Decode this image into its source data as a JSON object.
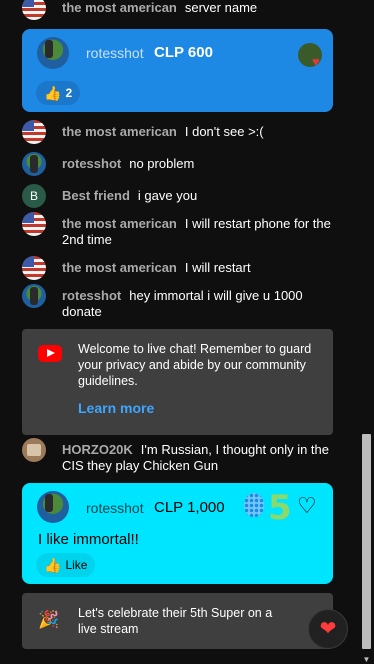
{
  "messages_top": [
    {
      "author": "the most american",
      "text": "server name",
      "avatar": "us-flag"
    },
    {
      "author": "the most american",
      "text": "I don't see >:(",
      "avatar": "us-flag"
    },
    {
      "author": "rotesshot",
      "text": "no problem",
      "avatar": "character"
    },
    {
      "author": "Best friend",
      "text": "i gave you",
      "avatar": "letter-b",
      "avatar_letter": "B"
    },
    {
      "author": "the most american",
      "text": "I will restart phone for the 2nd time",
      "avatar": "us-flag"
    },
    {
      "author": "the most american",
      "text": "I will restart",
      "avatar": "us-flag"
    },
    {
      "author": "rotesshot",
      "text": "hey immortal i will give u 1000 donate",
      "avatar": "character"
    }
  ],
  "super_chat_1": {
    "author": "rotesshot",
    "amount": "CLP 600",
    "likes": "2",
    "color": "#1e88e5"
  },
  "welcome": {
    "text": "Welcome to live chat! Remember to guard your privacy and abide by our community guidelines.",
    "link": "Learn more"
  },
  "message_horzo": {
    "author": "HORZO20K",
    "text": "I'm Russian, I thought only in the CIS they play Chicken Gun"
  },
  "super_chat_2": {
    "author": "rotesshot",
    "amount": "CLP 1,000",
    "badge_number": "5",
    "message": "I like immortal!!",
    "like_label": "Like",
    "color": "#00e5ff"
  },
  "celebrate": {
    "text": "Let's celebrate their 5th Super on a live stream"
  },
  "icons": {
    "heart_button": "heart-icon",
    "youtube": "youtube-icon",
    "party": "party-popper-icon"
  }
}
